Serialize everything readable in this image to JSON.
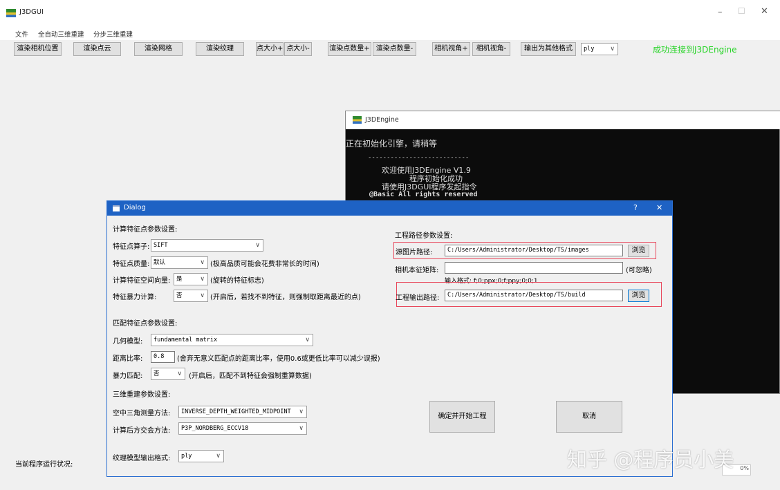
{
  "main": {
    "title": "J3DGUI",
    "menu": [
      "文件",
      "全自动三维重建",
      "分步三维重建"
    ],
    "toolbar": {
      "render_camera": "渲染相机位置",
      "render_points": "渲染点云",
      "render_mesh": "渲染网格",
      "render_texture": "渲染纹理",
      "point_bigger": "点大小+",
      "point_smaller": "点大小-",
      "points_more": "渲染点数量+",
      "points_less": "渲染点数量-",
      "view_up": "相机视角+",
      "view_down": "相机视角-",
      "export_other": "输出为其他格式",
      "format_value": "ply",
      "status": "成功连接到J3DEngine"
    },
    "status_label": "当前程序运行状况:",
    "status_tail": "0%",
    "colors": {
      "status_green": "#27d427"
    }
  },
  "console": {
    "title": "J3DEngine",
    "init": "正在初始化引擎，请稍等",
    "divider": "---------------------------",
    "welcome": "欢迎使用J3DEngine V1.9",
    "init_ok": "程序初始化成功",
    "hint": "请使用J3DGUI程序发起指令",
    "rights": "@Basic All rights reserved"
  },
  "dialog": {
    "title": "Dialog",
    "help": "?",
    "close": "✕",
    "feature": {
      "section": "计算特征点参数设置:",
      "operator_label": "特征点算子:",
      "operator_value": "SIFT",
      "quality_label": "特征点质量:",
      "quality_value": "默认",
      "quality_hint": "(极高品质可能会花费非常长的时间)",
      "orient_label": "计算特征空间向量:",
      "orient_value": "是",
      "orient_hint": "(旋转的特征标志)",
      "brute_label": "特征暴力计算:",
      "brute_value": "否",
      "brute_hint": "(开启后，若找不到特征，则强制取距离最近的点)"
    },
    "match": {
      "section": "匹配特征点参数设置:",
      "geom_label": "几何模型:",
      "geom_value": "fundamental matrix",
      "ratio_label": "距离比率:",
      "ratio_value": "0.8",
      "ratio_hint": "(舍弃无意义匹配点的距离比率，使用0.6或更低比率可以减少误报)",
      "brute_label": "暴力匹配:",
      "brute_value": "否",
      "brute_hint": "(开启后，匹配不到特征会强制重算数据)"
    },
    "recon": {
      "section": "三维重建参数设置:",
      "tri_label": "空中三角测量方法:",
      "tri_value": "INVERSE_DEPTH_WEIGHTED_MIDPOINT",
      "resect_label": "计算后方交会方法:",
      "resect_value": "P3P_NORDBERG_ECCV18"
    },
    "texture": {
      "label": "纹理模型输出格式:",
      "value": "ply"
    },
    "project": {
      "section": "工程路径参数设置:",
      "src_label": "源图片路径:",
      "src_value": "C:/Users/Administrator/Desktop/TS/images",
      "browse": "浏览",
      "intr_label": "相机本征矩阵:",
      "intr_value": "",
      "intr_optional": "(可忽略)",
      "intr_format": "输入格式: f;0;ppx;0;f;ppy;0;0;1",
      "out_label": "工程输出路径:",
      "out_value": "C:/Users/Administrator/Desktop/TS/build"
    },
    "confirm": "确定并开始工程",
    "cancel": "取消"
  },
  "watermark": "知乎 @程序员小美"
}
